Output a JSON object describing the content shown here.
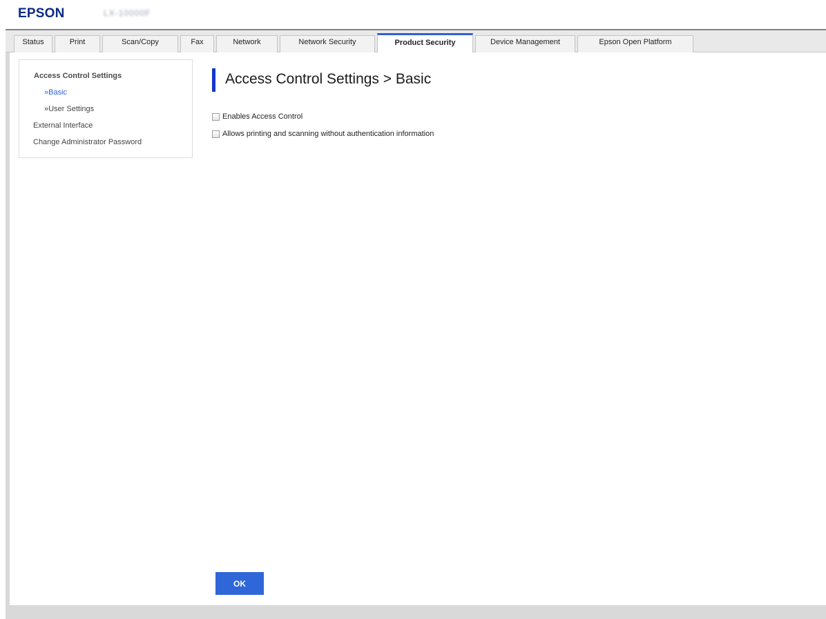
{
  "header": {
    "logo": "EPSON",
    "model": "LX-10000F"
  },
  "tabs": [
    {
      "label": "Status"
    },
    {
      "label": "Print"
    },
    {
      "label": "Scan/Copy"
    },
    {
      "label": "Fax"
    },
    {
      "label": "Network"
    },
    {
      "label": "Network Security"
    },
    {
      "label": "Product Security",
      "active": true
    },
    {
      "label": "Device Management"
    },
    {
      "label": "Epson Open Platform"
    }
  ],
  "sidebar": {
    "heading": "Access Control Settings",
    "sub_items": [
      {
        "label": "»Basic",
        "active": true
      },
      {
        "label": "»User Settings"
      }
    ],
    "items": [
      {
        "label": "External Interface"
      },
      {
        "label": "Change Administrator Password"
      }
    ]
  },
  "main": {
    "title": "Access Control Settings > Basic",
    "options": [
      {
        "label": "Enables Access Control",
        "checked": false
      },
      {
        "label": "Allows printing and scanning without authentication information",
        "checked": false
      }
    ],
    "ok_label": "OK"
  },
  "colors": {
    "accent": "#2f67d8",
    "title_bar": "#1536cc",
    "active_link": "#2f63d6",
    "logo": "#0a2a86"
  }
}
